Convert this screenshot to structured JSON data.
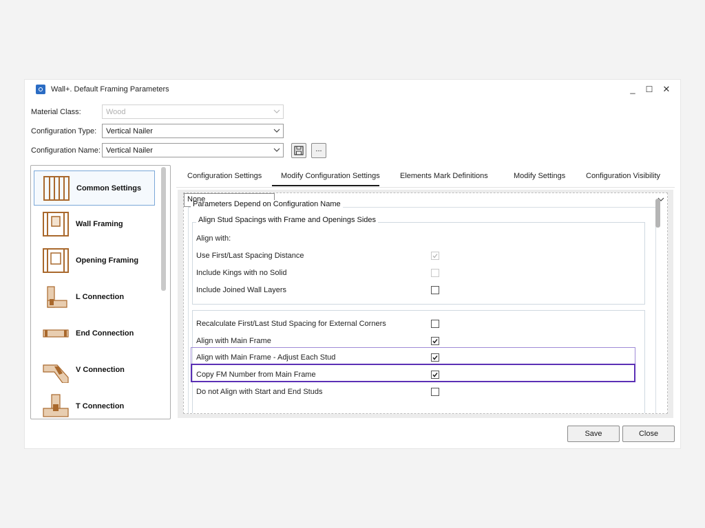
{
  "window": {
    "title": "Wall+. Default Framing Parameters",
    "controls": {
      "minimize": "_",
      "maximize": "☐",
      "close": "✕"
    }
  },
  "form": {
    "material_class": {
      "label": "Material Class:",
      "value": "Wood",
      "disabled": true
    },
    "configuration_type": {
      "label": "Configuration Type:",
      "value": "Vertical Nailer"
    },
    "configuration_name": {
      "label": "Configuration Name:",
      "value": "Vertical Nailer"
    },
    "more_button_label": "..."
  },
  "sidebar": {
    "items": [
      {
        "label": "Common Settings",
        "icon": "wall-studs-icon",
        "selected": true
      },
      {
        "label": "Wall Framing",
        "icon": "wall-framing-icon"
      },
      {
        "label": "Opening Framing",
        "icon": "opening-framing-icon"
      },
      {
        "label": "L Connection",
        "icon": "l-connection-icon"
      },
      {
        "label": "End Connection",
        "icon": "end-connection-icon"
      },
      {
        "label": "V Connection",
        "icon": "v-connection-icon"
      },
      {
        "label": "T Connection",
        "icon": "t-connection-icon"
      }
    ]
  },
  "tabs": [
    {
      "label": "Configuration Settings"
    },
    {
      "label": "Modify Configuration Settings",
      "active": true
    },
    {
      "label": "Elements Mark Definitions"
    },
    {
      "label": "Modify Settings"
    },
    {
      "label": "Configuration Visibility"
    }
  ],
  "content": {
    "outer_group_title": "Parameters Depend on Configuration Name",
    "align_group": {
      "title": "Align Stud Spacings with Frame and Openings Sides",
      "align_with": {
        "label": "Align with:",
        "value": "None"
      },
      "rows": [
        {
          "label": "Use First/Last Spacing Distance",
          "checked": true,
          "disabled": true
        },
        {
          "label": "Include Kings with no Solid",
          "checked": false,
          "disabled": true
        },
        {
          "label": "Include Joined Wall Layers",
          "checked": false,
          "disabled": false
        }
      ]
    },
    "second_group": {
      "rows": [
        {
          "label": "Recalculate First/Last Stud Spacing for External Corners",
          "checked": false
        },
        {
          "label": "Align with Main Frame",
          "checked": true
        },
        {
          "label": "Align with Main Frame - Adjust Each Stud",
          "checked": true
        },
        {
          "label": "Copy FM Number from Main Frame",
          "checked": true
        },
        {
          "label": "Do not Align with Start and End Studs",
          "checked": false
        }
      ]
    }
  },
  "footer": {
    "save_label": "Save",
    "close_label": "Close"
  },
  "colors": {
    "highlight": "#5b2fb5",
    "highlight_light": "#9e8ad6",
    "selection_border": "#7aa7d8",
    "wood": "#a9682c"
  }
}
